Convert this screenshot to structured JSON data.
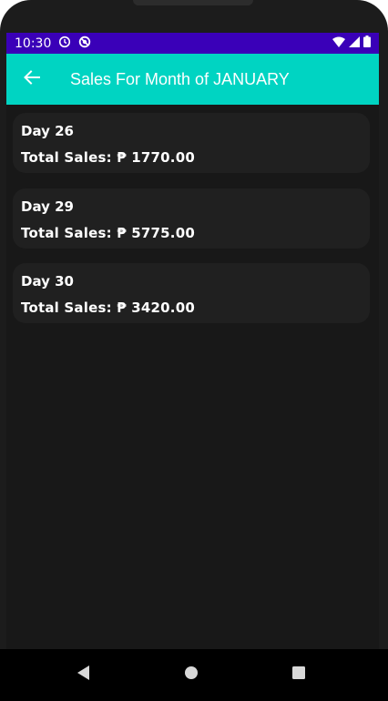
{
  "colors": {
    "status_bar": "#3a00b8",
    "app_bar": "#00d4c2",
    "background": "#181818",
    "card": "#202020"
  },
  "status_bar": {
    "time": "10:30",
    "left_icons": [
      "alarm-icon",
      "do-not-disturb-icon"
    ],
    "right_icons": [
      "wifi-icon",
      "cell-signal-icon",
      "battery-icon"
    ]
  },
  "app_bar": {
    "back_icon": "arrow-left-icon",
    "title": "Sales For Month of JANUARY"
  },
  "sales": [
    {
      "day": "Day 26",
      "total": "Total Sales: ₱ 1770.00"
    },
    {
      "day": "Day 29",
      "total": "Total Sales: ₱ 5775.00"
    },
    {
      "day": "Day 30",
      "total": "Total Sales: ₱ 3420.00"
    }
  ],
  "nav_bar": {
    "buttons": [
      "back-triangle-icon",
      "home-circle-icon",
      "recents-square-icon"
    ]
  }
}
